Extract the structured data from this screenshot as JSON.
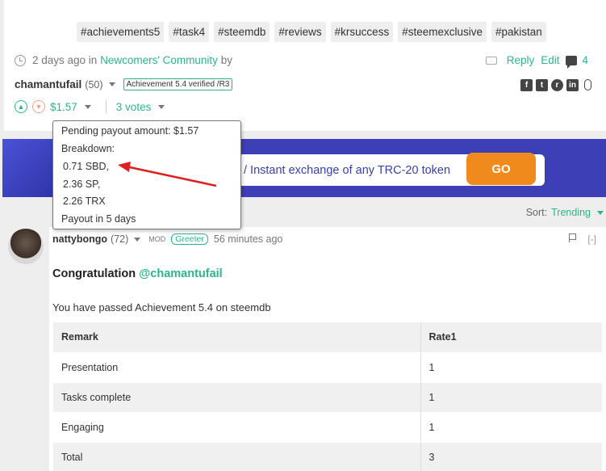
{
  "tags": [
    "#achievements5",
    "#task4",
    "#steemdb",
    "#reviews",
    "#krsuccess",
    "#steemexclusive",
    "#pakistan"
  ],
  "post_meta": {
    "time_text": "2 days ago in",
    "community": "Newcomers' Community",
    "by_text": "by"
  },
  "actions": {
    "reply": "Reply",
    "edit": "Edit",
    "comment_count": "4"
  },
  "author": {
    "name": "chamantufail",
    "reputation": "(50)",
    "badge": "Achievement 5.4 verified /R3"
  },
  "share": {
    "facebook": "f",
    "twitter": "t",
    "reddit": "r",
    "linkedin": "in"
  },
  "votes": {
    "payout": "$1.57",
    "count": "3 votes"
  },
  "popup": {
    "pending": "Pending payout amount: $1.57",
    "breakdown": "Breakdown:",
    "sbd": "0.71 SBD,",
    "sp": "2.36 SP,",
    "trx": "2.26 TRX",
    "payout_in": "Payout in 5 days"
  },
  "banner": {
    "text": "/ Instant exchange of any TRC-20 token",
    "go": "GO"
  },
  "sort": {
    "label": "Sort:",
    "value": "Trending"
  },
  "comment": {
    "author": "nattybongo",
    "reputation": "(72)",
    "mod": "MOD",
    "badge": "Greeter",
    "time": "56 minutes ago",
    "collapse": "[-]",
    "congrats_text": "Congratulation",
    "mention": "@chamantufail",
    "passed_text": "You have passed Achievement 5.4 on steemdb",
    "table": {
      "headers": [
        "Remark",
        "Rate1"
      ],
      "rows": [
        [
          "Presentation",
          "1"
        ],
        [
          "Tasks complete",
          "1"
        ],
        [
          "Engaging",
          "1"
        ],
        [
          "Total",
          "3"
        ]
      ]
    }
  },
  "colors": {
    "accent": "#2bb58c",
    "banner": "#3c3fb5",
    "go_button": "#f08a1c",
    "annotation_arrow": "#e02020"
  }
}
